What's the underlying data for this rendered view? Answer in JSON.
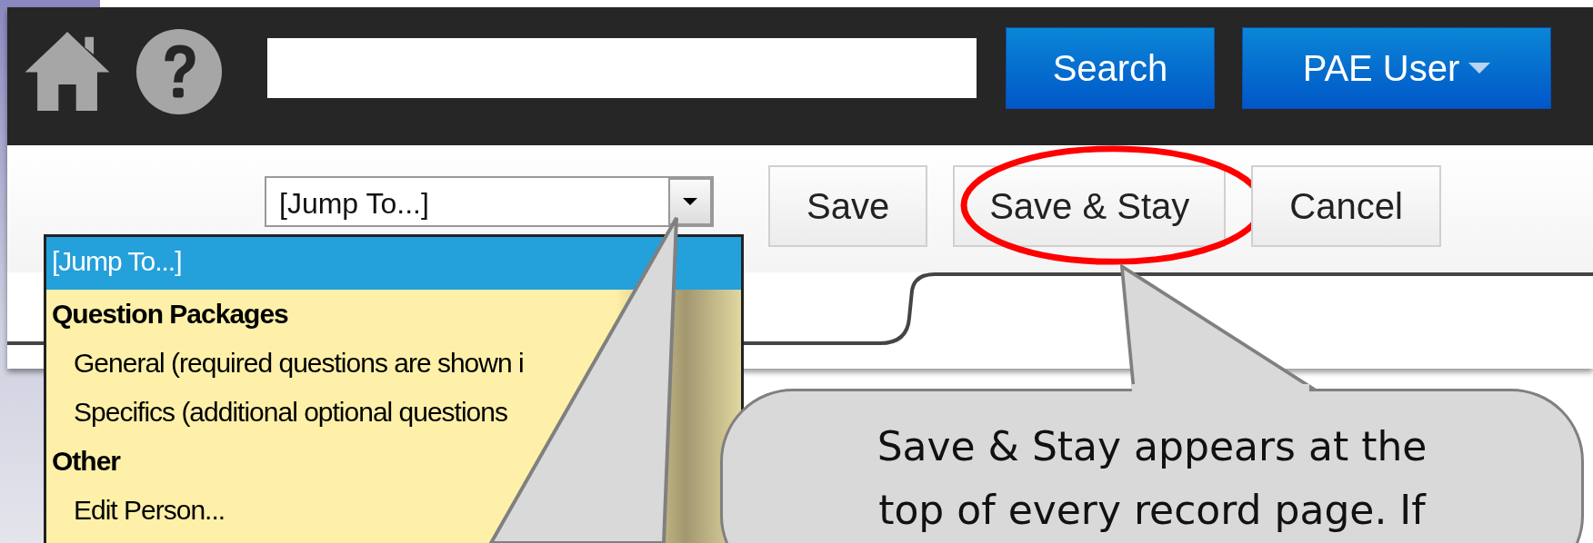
{
  "header": {
    "search_button": "Search",
    "user_menu": "PAE User"
  },
  "toolbar": {
    "jump_select": "[Jump To...]",
    "buttons": [
      {
        "label": "Save",
        "highlighted": false
      },
      {
        "label": "Save & Stay",
        "highlighted": true
      },
      {
        "label": "Cancel",
        "highlighted": false
      }
    ]
  },
  "jump_list": [
    {
      "kind": "option",
      "label": "[Jump To...]",
      "selected": true
    },
    {
      "kind": "group",
      "label": "Question Packages"
    },
    {
      "kind": "option",
      "label": "General (required questions are shown i",
      "selected": false
    },
    {
      "kind": "option",
      "label": "Specifics (additional optional questions",
      "selected": false
    },
    {
      "kind": "group",
      "label": "Other"
    },
    {
      "kind": "option",
      "label": "Edit Person...",
      "selected": false
    }
  ],
  "callout": {
    "text": "Save & Stay appears at the top of every record page. If"
  }
}
